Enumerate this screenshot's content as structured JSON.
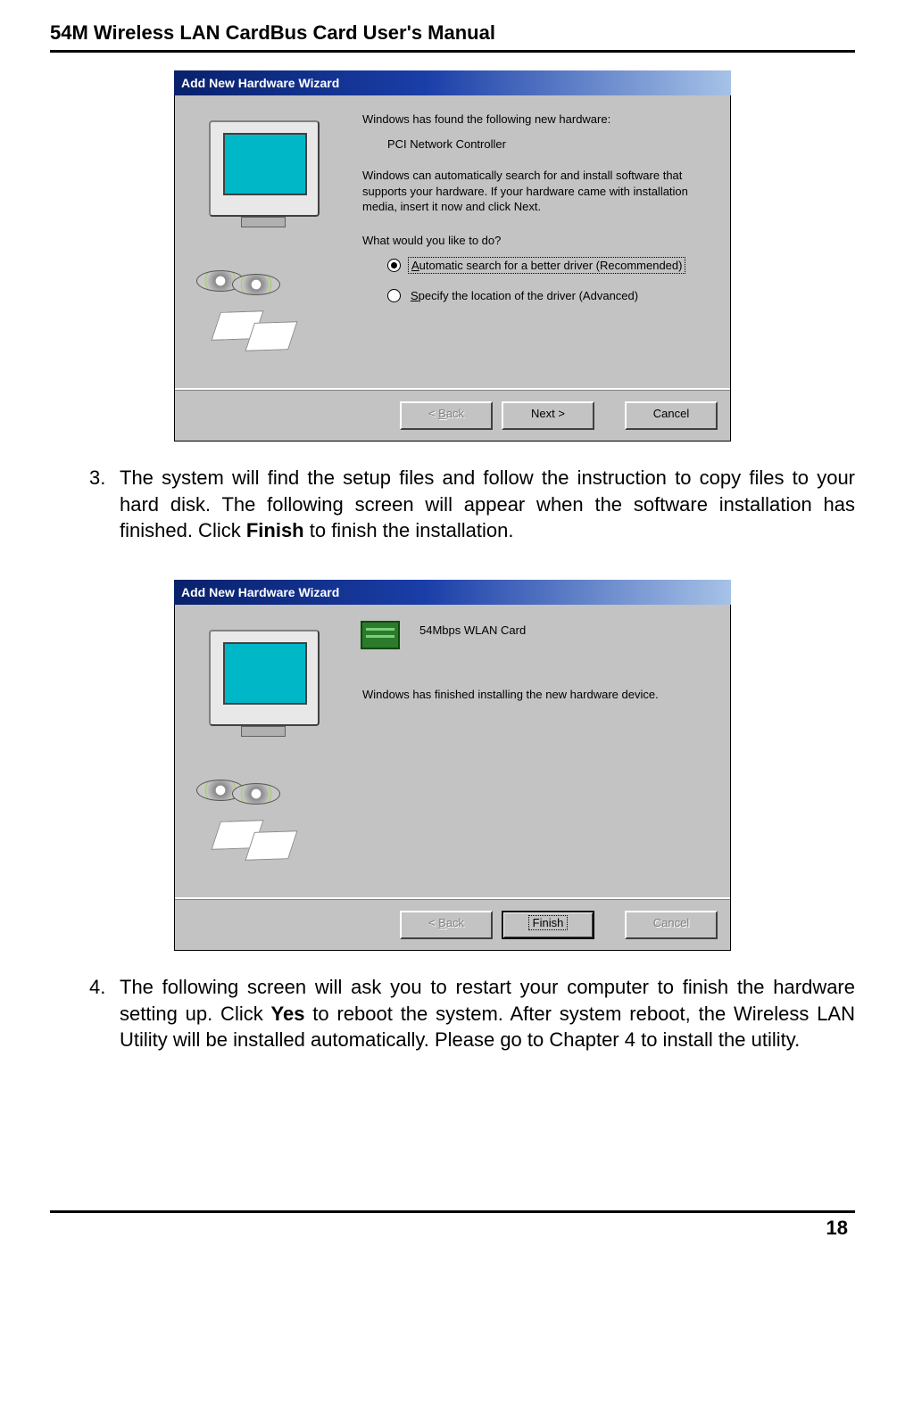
{
  "header": {
    "title": "54M Wireless LAN CardBus Card User's Manual"
  },
  "footer": {
    "page_number": "18"
  },
  "wizard1": {
    "title": "Add New Hardware Wizard",
    "line1": "Windows has found the following new hardware:",
    "device": "PCI Network Controller",
    "line2": "Windows can automatically search for and install software that supports your hardware. If your hardware came with installation media, insert it now and click Next.",
    "prompt": "What would you like to do?",
    "opt1_prefix": "A",
    "opt1_rest": "utomatic search for a better driver (Recommended)",
    "opt2_prefix": "S",
    "opt2_rest": "pecify the location of the driver (Advanced)",
    "back_u": "B",
    "back_rest": "ack",
    "next": "Next >",
    "cancel": "Cancel"
  },
  "step3": {
    "num": "3.",
    "text_a": "The system will find the setup files and follow the instruction to copy files to your hard disk. The following screen will appear when the software installation has finished. Click ",
    "bold": "Finish",
    "text_b": " to finish the installation."
  },
  "wizard2": {
    "title": "Add New Hardware Wizard",
    "device": "54Mbps WLAN Card",
    "line1": "Windows has finished installing the new hardware device.",
    "back_u": "B",
    "back_rest": "ack",
    "finish": "Finish",
    "cancel": "Cancel"
  },
  "step4": {
    "num": "4.",
    "text_a": "The following screen will ask you to restart your computer to finish the hardware setting up. Click ",
    "bold": "Yes",
    "text_b": " to reboot the system. After system reboot, the Wireless LAN Utility will be installed automatically. Please go to Chapter 4 to install the utility."
  }
}
